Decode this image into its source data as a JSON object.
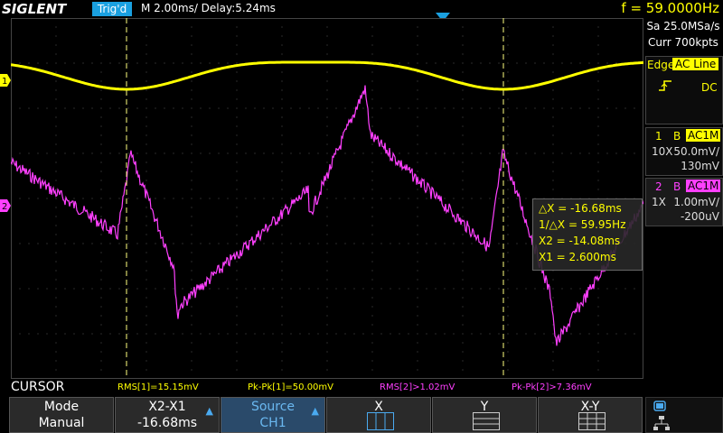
{
  "brand": "SIGLENT",
  "trigger_status": "Trig'd",
  "timebase": "M 2.00ms/ Delay:5.24ms",
  "frequency": "f = 59.0000Hz",
  "acquisition": {
    "sample_rate": "Sa 25.0MSa/s",
    "memory": "Curr 700kpts"
  },
  "trigger": {
    "type": "Edge",
    "source": "AC Line",
    "slope_icon": "rising-edge-icon",
    "coupling": "DC"
  },
  "channels": [
    {
      "number": "1",
      "bw": "B",
      "coupling": "AC1M",
      "probe": "10X",
      "vdiv": "50.0mV/",
      "offset": "130mV",
      "color": "#ffff00",
      "marker": "1"
    },
    {
      "number": "2",
      "bw": "B",
      "coupling": "AC1M",
      "probe": "1X",
      "vdiv": "1.00mV/",
      "offset": "-200uV",
      "color": "#ff40ff",
      "marker": "2"
    }
  ],
  "cursor_readout": {
    "dx": "△X = -16.68ms",
    "inv_dx": "1/△X = 59.95Hz",
    "x2": "X2 = -14.08ms",
    "x1": "X1 = 2.600ms"
  },
  "mode_label": "CURSOR",
  "measurements": [
    {
      "text": "RMS[1]=15.15mV",
      "color": "#ffff00"
    },
    {
      "text": "Pk-Pk[1]=50.00mV",
      "color": "#ffff00"
    },
    {
      "text": "RMS[2]>1.02mV",
      "color": "#ff40ff"
    },
    {
      "text": "Pk-Pk[2]>7.36mV",
      "color": "#ff40ff"
    }
  ],
  "softkeys": {
    "mode": {
      "title": "Mode",
      "value": "Manual"
    },
    "x2x1": {
      "title": "X2-X1",
      "value": "-16.68ms"
    },
    "source": {
      "title": "Source",
      "value": "CH1"
    },
    "x": {
      "title": "X"
    },
    "y": {
      "title": "Y"
    },
    "xy": {
      "title": "X-Y"
    }
  },
  "colors": {
    "ch1": "#ffff00",
    "ch2": "#ff40ff",
    "accent": "#1aa0e0",
    "grid": "#444444"
  }
}
